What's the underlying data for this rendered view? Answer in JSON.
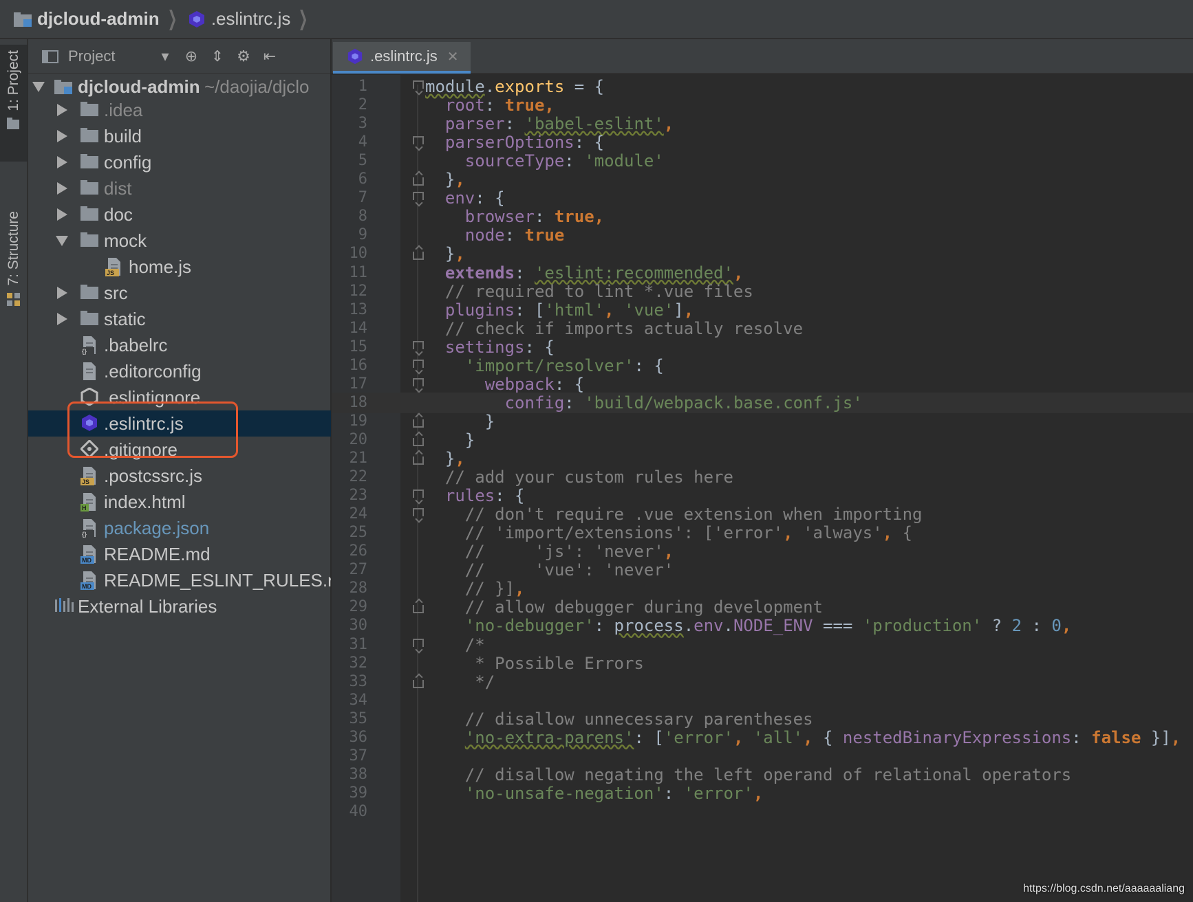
{
  "breadcrumb": {
    "project": "djcloud-admin",
    "file": ".eslintrc.js"
  },
  "toolstrip": {
    "project_tab": "1: Project",
    "structure_tab": "7: Structure"
  },
  "project_panel": {
    "header_label": "Project",
    "root_name": "djcloud-admin",
    "root_path": "~/daojia/djclo",
    "items": [
      {
        "label": ".idea",
        "kind": "folder",
        "dim": true
      },
      {
        "label": "build",
        "kind": "folder"
      },
      {
        "label": "config",
        "kind": "folder"
      },
      {
        "label": "dist",
        "kind": "folder",
        "dim": true
      },
      {
        "label": "doc",
        "kind": "folder"
      },
      {
        "label": "mock",
        "kind": "folder"
      },
      {
        "label": "home.js",
        "kind": "file"
      },
      {
        "label": "src",
        "kind": "folder"
      },
      {
        "label": "static",
        "kind": "folder"
      },
      {
        "label": ".babelrc",
        "kind": "file"
      },
      {
        "label": ".editorconfig",
        "kind": "file"
      },
      {
        "label": ".eslintignore",
        "kind": "file"
      },
      {
        "label": ".eslintrc.js",
        "kind": "file",
        "selected": true
      },
      {
        "label": ".gitignore",
        "kind": "file"
      },
      {
        "label": ".postcssrc.js",
        "kind": "file"
      },
      {
        "label": "index.html",
        "kind": "file"
      },
      {
        "label": "package.json",
        "kind": "file"
      },
      {
        "label": "README.md",
        "kind": "file"
      },
      {
        "label": "README_ESLINT_RULES.r",
        "kind": "file"
      },
      {
        "label": "External Libraries",
        "kind": "libraries"
      }
    ]
  },
  "editor": {
    "tab_label": ".eslintrc.js",
    "current_line": 18,
    "lines": [
      {
        "n": "1",
        "code": "module.exports = {"
      },
      {
        "n": "2",
        "code": "  root: true,"
      },
      {
        "n": "3",
        "code": "  parser: 'babel-eslint',"
      },
      {
        "n": "4",
        "code": "  parserOptions: {"
      },
      {
        "n": "5",
        "code": "    sourceType: 'module'"
      },
      {
        "n": "6",
        "code": "  },"
      },
      {
        "n": "7",
        "code": "  env: {"
      },
      {
        "n": "8",
        "code": "    browser: true,"
      },
      {
        "n": "9",
        "code": "    node: true"
      },
      {
        "n": "10",
        "code": "  },"
      },
      {
        "n": "11",
        "code": "  extends: 'eslint:recommended',"
      },
      {
        "n": "12",
        "code": "  // required to lint *.vue files"
      },
      {
        "n": "13",
        "code": "  plugins: ['html', 'vue'],"
      },
      {
        "n": "14",
        "code": "  // check if imports actually resolve"
      },
      {
        "n": "15",
        "code": "  settings: {"
      },
      {
        "n": "16",
        "code": "    'import/resolver': {"
      },
      {
        "n": "17",
        "code": "      webpack: {"
      },
      {
        "n": "18",
        "code": "        config: 'build/webpack.base.conf.js'"
      },
      {
        "n": "19",
        "code": "      }"
      },
      {
        "n": "20",
        "code": "    }"
      },
      {
        "n": "21",
        "code": "  },"
      },
      {
        "n": "22",
        "code": "  // add your custom rules here"
      },
      {
        "n": "23",
        "code": "  rules: {"
      },
      {
        "n": "24",
        "code": "    // don't require .vue extension when importing"
      },
      {
        "n": "25",
        "code": "    // 'import/extensions': ['error', 'always', {"
      },
      {
        "n": "26",
        "code": "    //     'js': 'never',"
      },
      {
        "n": "27",
        "code": "    //     'vue': 'never'"
      },
      {
        "n": "28",
        "code": "    // }],"
      },
      {
        "n": "29",
        "code": "    // allow debugger during development"
      },
      {
        "n": "30",
        "code": "    'no-debugger': process.env.NODE_ENV === 'production' ? 2 : 0,"
      },
      {
        "n": "31",
        "code": "    /*"
      },
      {
        "n": "32",
        "code": "     * Possible Errors"
      },
      {
        "n": "33",
        "code": "     */"
      },
      {
        "n": "34",
        "code": ""
      },
      {
        "n": "35",
        "code": "    // disallow unnecessary parentheses"
      },
      {
        "n": "36",
        "code": "    'no-extra-parens': ['error', 'all', { nestedBinaryExpressions: false }],"
      },
      {
        "n": "37",
        "code": ""
      },
      {
        "n": "38",
        "code": "    // disallow negating the left operand of relational operators"
      },
      {
        "n": "39",
        "code": "    'no-unsafe-negation': 'error',"
      },
      {
        "n": "40",
        "code": ""
      }
    ]
  },
  "watermark": "https://blog.csdn.net/aaaaaaliang",
  "colors": {
    "keyword": "#cc7832",
    "string": "#6a8759",
    "comment": "#808080",
    "property": "#9876aa",
    "number": "#6897bb",
    "highlight_box": "#e4572e",
    "selection": "#0d293e"
  }
}
